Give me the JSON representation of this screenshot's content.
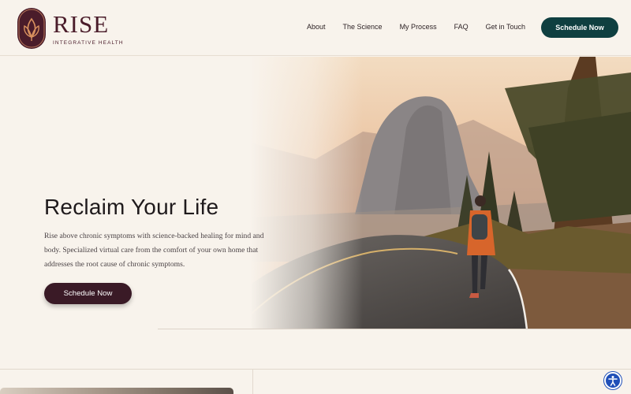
{
  "brand": {
    "name": "RISE",
    "tagline": "INTEGRATIVE HEALTH",
    "color": "#4a1c2a"
  },
  "nav": {
    "items": [
      {
        "label": "About"
      },
      {
        "label": "The Science"
      },
      {
        "label": "My Process"
      },
      {
        "label": "FAQ"
      },
      {
        "label": "Get in Touch"
      }
    ],
    "cta": "Schedule Now",
    "cta_color": "#0f3f40"
  },
  "hero": {
    "title": "Reclaim Your Life",
    "description": "Rise above chronic symptoms with science-backed healing for mind and body. Specialized virtual care from the comfort of your own home that addresses the root cause of chronic symptoms.",
    "cta": "Schedule Now",
    "cta_color": "#3a1a26",
    "image": "woman-walking-mountain-road"
  },
  "accessibility": {
    "icon": "accessibility-icon",
    "color": "#1f4fb8"
  }
}
